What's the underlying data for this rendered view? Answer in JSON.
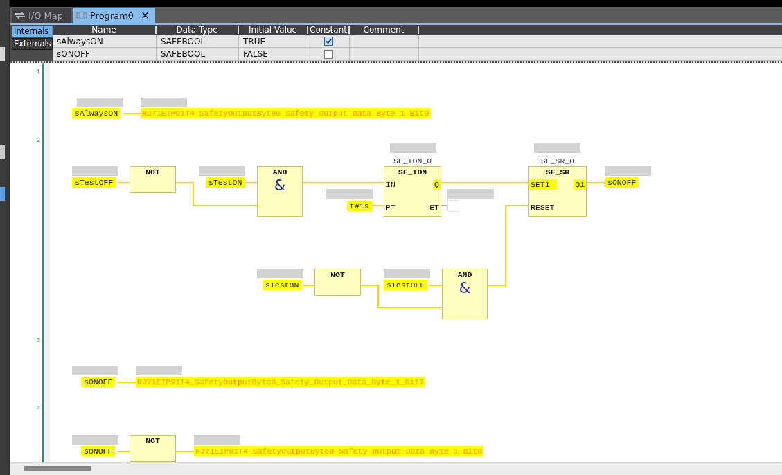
{
  "tabs": [
    {
      "label": "I/O Map",
      "selected": false
    },
    {
      "label": "Program0",
      "selected": true,
      "close": "×"
    }
  ],
  "variable_table": {
    "views": [
      {
        "label": "Internals",
        "selected": true
      },
      {
        "label": "Externals",
        "selected": false
      }
    ],
    "columns": [
      "Name",
      "Data Type",
      "Initial Value",
      "Constant",
      "Comment"
    ],
    "rows": [
      {
        "name": "sAlwaysON",
        "data_type": "SAFEBOOL",
        "initial_value": "TRUE",
        "constant": true
      },
      {
        "name": "sONOFF",
        "data_type": "SAFEBOOL",
        "initial_value": "FALSE",
        "constant": false
      }
    ]
  },
  "editor": {
    "networks": [
      {
        "number": "1",
        "elements": [
          {
            "kind": "variable",
            "text": "sAlwaysON"
          },
          {
            "kind": "output",
            "text": "RJ71EIP91T4_SafetyOutputByte0_Safety_Output_Data_Byte_1_Bit0"
          }
        ]
      },
      {
        "number": "2",
        "elements": [
          {
            "kind": "variable",
            "text": "sTestOFF"
          },
          {
            "kind": "block",
            "title": "NOT"
          },
          {
            "kind": "variable",
            "text": "sTestON"
          },
          {
            "kind": "block",
            "title": "AND",
            "symbol": "&"
          },
          {
            "kind": "variable",
            "text": "t#1s"
          },
          {
            "kind": "function_block",
            "instance": "SF_TON_0",
            "title": "SF_TON",
            "inputs": [
              {
                "label": "IN",
                "highlighted": false
              },
              {
                "label": "PT",
                "highlighted": false
              }
            ],
            "outputs": [
              {
                "label": "Q",
                "highlighted": true
              },
              {
                "label": "ET",
                "highlighted": false
              }
            ]
          },
          {
            "kind": "empty_output"
          },
          {
            "kind": "function_block",
            "instance": "SF_SR_0",
            "title": "SF_SR",
            "inputs": [
              {
                "label": "SET1",
                "highlighted": true
              },
              {
                "label": "RESET",
                "highlighted": false
              }
            ],
            "outputs": [
              {
                "label": "Q1",
                "highlighted": true
              }
            ]
          },
          {
            "kind": "variable",
            "text": "sONOFF"
          },
          {
            "kind": "variable",
            "text": "sTestON"
          },
          {
            "kind": "block",
            "title": "NOT"
          },
          {
            "kind": "variable",
            "text": "sTestOFF"
          },
          {
            "kind": "block",
            "title": "AND",
            "symbol": "&"
          }
        ]
      },
      {
        "number": "3",
        "elements": [
          {
            "kind": "variable",
            "text": "sONOFF"
          },
          {
            "kind": "output",
            "text": "RJ71EIP91T4_SafetyOutputByte0_Safety_Output_Data_Byte_1_Bit7"
          }
        ]
      },
      {
        "number": "4",
        "elements": [
          {
            "kind": "variable",
            "text": "sONOFF"
          },
          {
            "kind": "block",
            "title": "NOT"
          },
          {
            "kind": "output",
            "text": "RJ71EIP91T4_SafetyOutputByte0_Safety_Output_Data_Byte_1_Bit6"
          }
        ]
      }
    ]
  }
}
